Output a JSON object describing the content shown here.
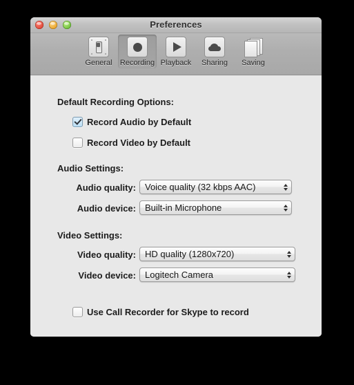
{
  "window": {
    "title": "Preferences",
    "controls": [
      {
        "name": "close",
        "color": "#e04a3a"
      },
      {
        "name": "minimize",
        "color": "#eaa62c"
      },
      {
        "name": "zoom",
        "color": "#73c23e"
      }
    ]
  },
  "toolbar": {
    "items": [
      {
        "label": "General",
        "icon": "switch-plate-icon",
        "selected": false
      },
      {
        "label": "Recording",
        "icon": "record-dot-icon",
        "selected": true
      },
      {
        "label": "Playback",
        "icon": "play-triangle-icon",
        "selected": false
      },
      {
        "label": "Sharing",
        "icon": "cloud-icon",
        "selected": false
      },
      {
        "label": "Saving",
        "icon": "documents-icon",
        "selected": false
      }
    ]
  },
  "content": {
    "sections": [
      {
        "heading": "Default Recording Options:"
      },
      {
        "heading": "Audio Settings:"
      },
      {
        "heading": "Video Settings:"
      }
    ],
    "checkboxes": [
      {
        "label": "Record Audio by Default",
        "checked": true
      },
      {
        "label": "Record Video by Default",
        "checked": false
      },
      {
        "label": "Use Call Recorder for Skype to record",
        "checked": false
      }
    ],
    "popups": [
      {
        "label": "Audio quality:",
        "value": "Voice quality (32 kbps AAC)"
      },
      {
        "label": "Audio device:",
        "value": "Built-in Microphone"
      },
      {
        "label": "Video quality:",
        "value": "HD quality (1280x720)"
      },
      {
        "label": "Video device:",
        "value": "Logitech Camera"
      }
    ]
  }
}
